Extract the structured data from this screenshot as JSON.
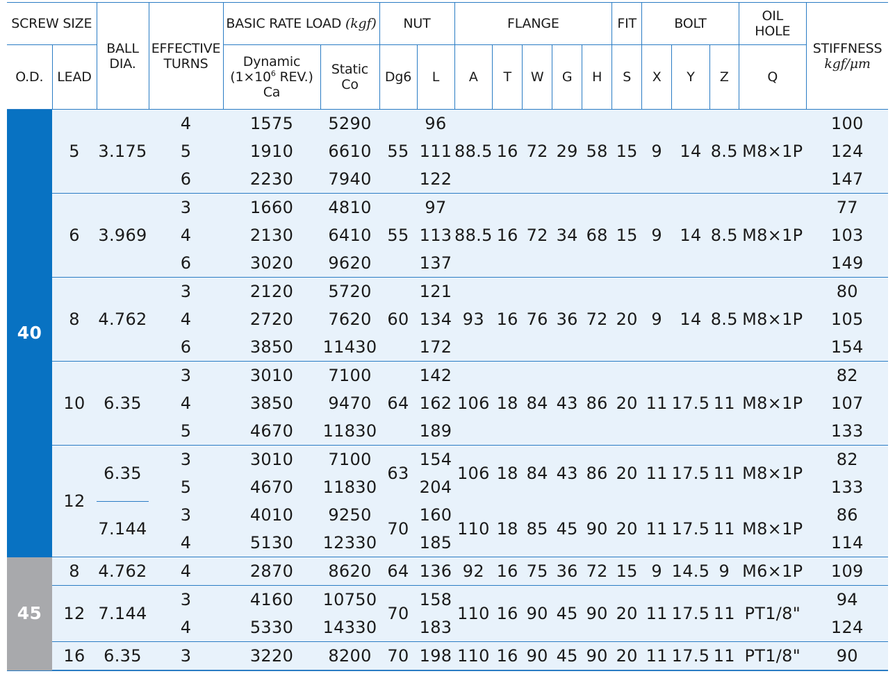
{
  "header": {
    "screw_size": "SCREW SIZE",
    "od": "O.D.",
    "lead": "LEAD",
    "ball_dia_1": "BALL",
    "ball_dia_2": "DIA.",
    "effective_turns_1": "EFFECTIVE",
    "effective_turns_2": "TURNS",
    "basic_rate_load": "BASIC RATE LOAD",
    "basic_rate_load_unit": "(kgf)",
    "dynamic_1": "Dynamic",
    "dynamic_2a": "(1×10",
    "dynamic_2_exp": "6",
    "dynamic_2b": " REV.)",
    "dynamic_3": "Ca",
    "static_1": "Static",
    "static_2": "Co",
    "nut": "NUT",
    "nut_dg6": "Dg6",
    "nut_l": "L",
    "flange": "FLANGE",
    "flange_a": "A",
    "flange_t": "T",
    "flange_w": "W",
    "flange_g": "G",
    "flange_h": "H",
    "fit": "FIT",
    "fit_s": "S",
    "bolt": "BOLT",
    "bolt_x": "X",
    "bolt_y": "Y",
    "bolt_z": "Z",
    "oil_hole_1": "OIL",
    "oil_hole_2": "HOLE",
    "oil_q": "Q",
    "stiffness": "STIFFNESS",
    "stiffness_unit": "kgf/μm"
  },
  "colors": {
    "od40": "#0872c2",
    "od45": "#a8a9ac",
    "row_bg": "#e8f2fb",
    "rule": "#2a7cc4"
  },
  "groups": [
    {
      "od": "40",
      "lead5": {
        "lead": "5",
        "ball": "3.175",
        "turns": [
          "4",
          "5",
          "6"
        ],
        "ca": [
          "1575",
          "1910",
          "2230"
        ],
        "co": [
          "5290",
          "6610",
          "7940"
        ],
        "dg6": "55",
        "l": [
          "96",
          "111",
          "122"
        ],
        "a": "88.5",
        "t": "16",
        "w": "72",
        "g": "29",
        "h": "58",
        "s": "15",
        "x": "9",
        "y": "14",
        "z": "8.5",
        "q": "M8×1P",
        "stiff": [
          "100",
          "124",
          "147"
        ]
      },
      "lead6": {
        "lead": "6",
        "ball": "3.969",
        "turns": [
          "3",
          "4",
          "6"
        ],
        "ca": [
          "1660",
          "2130",
          "3020"
        ],
        "co": [
          "4810",
          "6410",
          "9620"
        ],
        "dg6": "55",
        "l": [
          "97",
          "113",
          "137"
        ],
        "a": "88.5",
        "t": "16",
        "w": "72",
        "g": "34",
        "h": "68",
        "s": "15",
        "x": "9",
        "y": "14",
        "z": "8.5",
        "q": "M8×1P",
        "stiff": [
          "77",
          "103",
          "149"
        ]
      },
      "lead8": {
        "lead": "8",
        "ball": "4.762",
        "turns": [
          "3",
          "4",
          "6"
        ],
        "ca": [
          "2120",
          "2720",
          "3850"
        ],
        "co": [
          "5720",
          "7620",
          "11430"
        ],
        "dg6": "60",
        "l": [
          "121",
          "134",
          "172"
        ],
        "a": "93",
        "t": "16",
        "w": "76",
        "g": "36",
        "h": "72",
        "s": "20",
        "x": "9",
        "y": "14",
        "z": "8.5",
        "q": "M8×1P",
        "stiff": [
          "80",
          "105",
          "154"
        ]
      },
      "lead10": {
        "lead": "10",
        "ball": "6.35",
        "turns": [
          "3",
          "4",
          "5"
        ],
        "ca": [
          "3010",
          "3850",
          "4670"
        ],
        "co": [
          "7100",
          "9470",
          "11830"
        ],
        "dg6": "64",
        "l": [
          "142",
          "162",
          "189"
        ],
        "a": "106",
        "t": "18",
        "w": "84",
        "g": "43",
        "h": "86",
        "s": "20",
        "x": "11",
        "y": "17.5",
        "z": "11",
        "q": "M8×1P",
        "stiff": [
          "82",
          "107",
          "133"
        ]
      },
      "lead12": {
        "lead": "12",
        "a": {
          "ball": "6.35",
          "turns": [
            "3",
            "5"
          ],
          "ca": [
            "3010",
            "4670"
          ],
          "co": [
            "7100",
            "11830"
          ],
          "dg6": "63",
          "l": [
            "154",
            "204"
          ],
          "fa": "106",
          "t": "18",
          "w": "84",
          "g": "43",
          "h": "86",
          "s": "20",
          "x": "11",
          "y": "17.5",
          "z": "11",
          "q": "M8×1P",
          "stiff": [
            "82",
            "133"
          ]
        },
        "b": {
          "ball": "7.144",
          "turns": [
            "3",
            "4"
          ],
          "ca": [
            "4010",
            "5130"
          ],
          "co": [
            "9250",
            "12330"
          ],
          "dg6": "70",
          "l": [
            "160",
            "185"
          ],
          "fa": "110",
          "t": "18",
          "w": "85",
          "g": "45",
          "h": "90",
          "s": "20",
          "x": "11",
          "y": "17.5",
          "z": "11",
          "q": "M8×1P",
          "stiff": [
            "86",
            "114"
          ]
        }
      }
    },
    {
      "od": "45",
      "lead8": {
        "lead": "8",
        "ball": "4.762",
        "turns": [
          "4"
        ],
        "ca": [
          "2870"
        ],
        "co": [
          "8620"
        ],
        "dg6": "64",
        "l": [
          "136"
        ],
        "a": "92",
        "t": "16",
        "w": "75",
        "g": "36",
        "h": "72",
        "s": "15",
        "x": "9",
        "y": "14.5",
        "z": "9",
        "q": "M6×1P",
        "stiff": [
          "109"
        ]
      },
      "lead12": {
        "lead": "12",
        "ball": "7.144",
        "turns": [
          "3",
          "4"
        ],
        "ca": [
          "4160",
          "5330"
        ],
        "co": [
          "10750",
          "14330"
        ],
        "dg6": "70",
        "l": [
          "158",
          "183"
        ],
        "a": "110",
        "t": "16",
        "w": "90",
        "g": "45",
        "h": "90",
        "s": "20",
        "x": "11",
        "y": "17.5",
        "z": "11",
        "q": "PT1/8\"",
        "stiff": [
          "94",
          "124"
        ]
      },
      "lead16": {
        "lead": "16",
        "ball": "6.35",
        "turns": [
          "3"
        ],
        "ca": [
          "3220"
        ],
        "co": [
          "8200"
        ],
        "dg6": "70",
        "l": [
          "198"
        ],
        "a": "110",
        "t": "16",
        "w": "90",
        "g": "45",
        "h": "90",
        "s": "20",
        "x": "11",
        "y": "17.5",
        "z": "11",
        "q": "PT1/8\"",
        "stiff": [
          "90"
        ]
      }
    }
  ]
}
